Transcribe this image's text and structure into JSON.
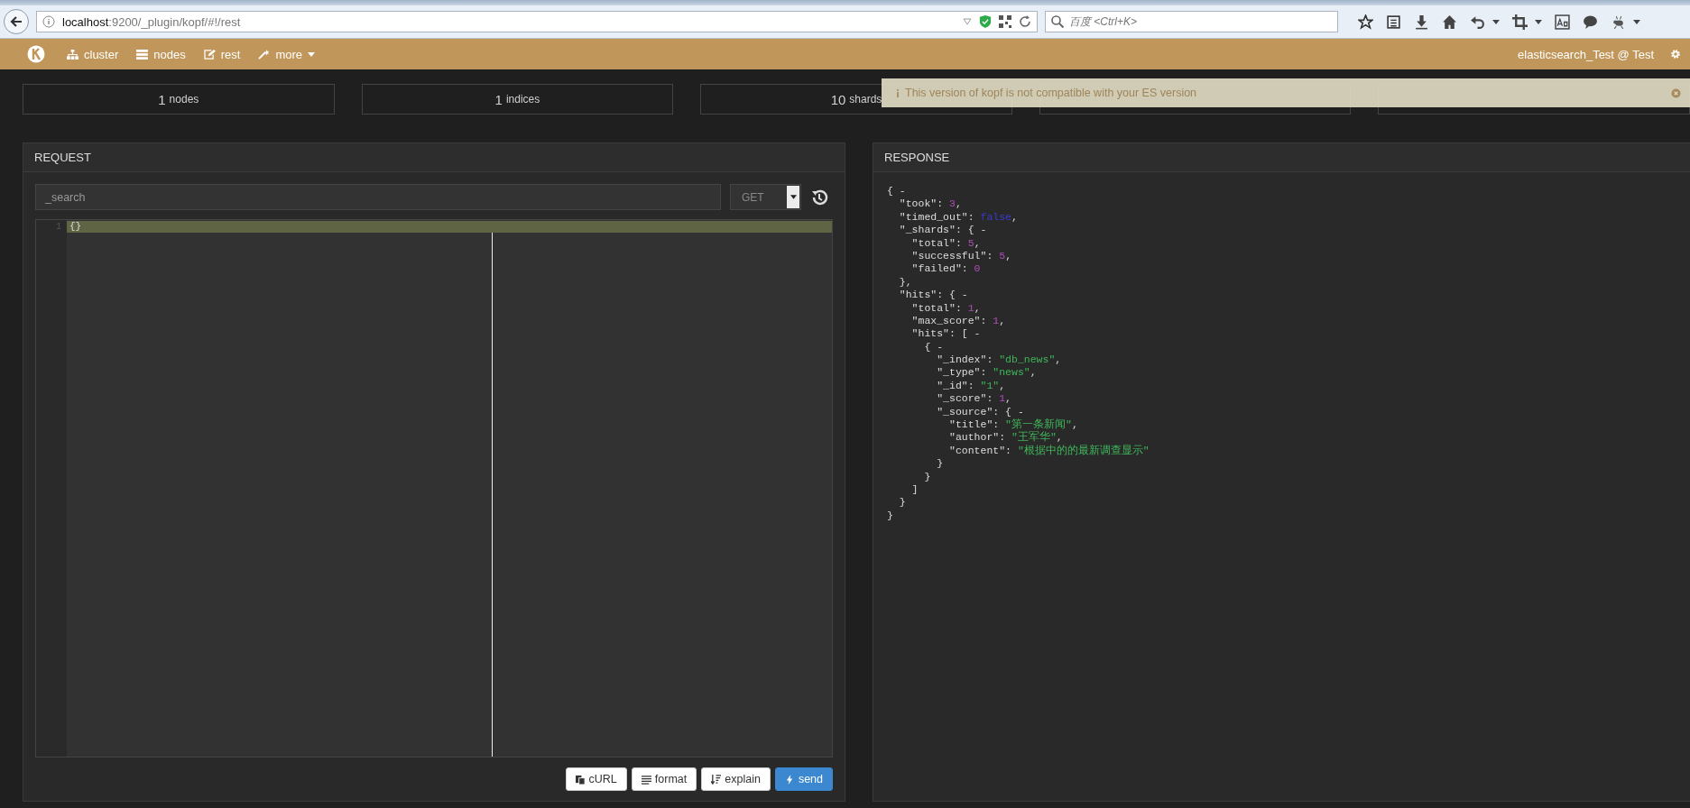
{
  "browser": {
    "url_host": "localhost",
    "url_rest": ":9200/_plugin/kopf/#!/rest",
    "search_placeholder": "百度 <Ctrl+K>"
  },
  "navbar": {
    "items": [
      {
        "label": "cluster",
        "dropdown": false
      },
      {
        "label": "nodes",
        "dropdown": false
      },
      {
        "label": "rest",
        "dropdown": false
      },
      {
        "label": "more",
        "dropdown": true
      }
    ],
    "cluster_name": "elasticsearch_Test @ Test"
  },
  "stats": [
    {
      "value": "1",
      "label": "nodes"
    },
    {
      "value": "1",
      "label": "indices"
    },
    {
      "value": "10",
      "label": "shards"
    }
  ],
  "alert": {
    "message": "This version of kopf is not compatible with your ES version"
  },
  "request": {
    "title": "REQUEST",
    "path": "_search",
    "method": "GET",
    "editor_lines": [
      {
        "number": "1",
        "text": "{}",
        "highlighted": true
      }
    ],
    "buttons": [
      {
        "label": "cURL",
        "kind": "curl",
        "primary": false
      },
      {
        "label": "format",
        "kind": "format",
        "primary": false
      },
      {
        "label": "explain",
        "kind": "explain",
        "primary": false
      },
      {
        "label": "send",
        "kind": "send",
        "primary": true
      }
    ]
  },
  "response": {
    "title": "RESPONSE",
    "body": {
      "line": [
        {
          "kind": "text",
          "text": "{ -"
        }
      ],
      "close": [
        {
          "kind": "text",
          "text": "}"
        }
      ],
      "children": [
        {
          "line": [
            {
              "kind": "text",
              "text": "\"took\": "
            },
            {
              "kind": "number",
              "text": "3"
            },
            {
              "kind": "text",
              "text": ","
            }
          ]
        },
        {
          "line": [
            {
              "kind": "text",
              "text": "\"timed_out\": "
            },
            {
              "kind": "boolean",
              "text": "false"
            },
            {
              "kind": "text",
              "text": ","
            }
          ]
        },
        {
          "line": [
            {
              "kind": "text",
              "text": "\"_shards\": { -"
            }
          ],
          "close": [
            {
              "kind": "text",
              "text": "},"
            }
          ],
          "children": [
            {
              "line": [
                {
                  "kind": "text",
                  "text": "\"total\": "
                },
                {
                  "kind": "number",
                  "text": "5"
                },
                {
                  "kind": "text",
                  "text": ","
                }
              ]
            },
            {
              "line": [
                {
                  "kind": "text",
                  "text": "\"successful\": "
                },
                {
                  "kind": "number",
                  "text": "5"
                },
                {
                  "kind": "text",
                  "text": ","
                }
              ]
            },
            {
              "line": [
                {
                  "kind": "text",
                  "text": "\"failed\": "
                },
                {
                  "kind": "number",
                  "text": "0"
                }
              ]
            }
          ]
        },
        {
          "line": [
            {
              "kind": "text",
              "text": "\"hits\": { -"
            }
          ],
          "close": [
            {
              "kind": "text",
              "text": "}"
            }
          ],
          "children": [
            {
              "line": [
                {
                  "kind": "text",
                  "text": "\"total\": "
                },
                {
                  "kind": "number",
                  "text": "1"
                },
                {
                  "kind": "text",
                  "text": ","
                }
              ]
            },
            {
              "line": [
                {
                  "kind": "text",
                  "text": "\"max_score\": "
                },
                {
                  "kind": "number",
                  "text": "1"
                },
                {
                  "kind": "text",
                  "text": ","
                }
              ]
            },
            {
              "line": [
                {
                  "kind": "text",
                  "text": "\"hits\": [ -"
                }
              ],
              "close": [
                {
                  "kind": "text",
                  "text": "]"
                }
              ],
              "children": [
                {
                  "line": [
                    {
                      "kind": "text",
                      "text": "{ -"
                    }
                  ],
                  "close": [
                    {
                      "kind": "text",
                      "text": "}"
                    }
                  ],
                  "children": [
                    {
                      "line": [
                        {
                          "kind": "text",
                          "text": "\"_index\": "
                        },
                        {
                          "kind": "string",
                          "text": "\"db_news\""
                        },
                        {
                          "kind": "text",
                          "text": ","
                        }
                      ]
                    },
                    {
                      "line": [
                        {
                          "kind": "text",
                          "text": "\"_type\": "
                        },
                        {
                          "kind": "string",
                          "text": "\"news\""
                        },
                        {
                          "kind": "text",
                          "text": ","
                        }
                      ]
                    },
                    {
                      "line": [
                        {
                          "kind": "text",
                          "text": "\"_id\": "
                        },
                        {
                          "kind": "string",
                          "text": "\"1\""
                        },
                        {
                          "kind": "text",
                          "text": ","
                        }
                      ]
                    },
                    {
                      "line": [
                        {
                          "kind": "text",
                          "text": "\"_score\": "
                        },
                        {
                          "kind": "number",
                          "text": "1"
                        },
                        {
                          "kind": "text",
                          "text": ","
                        }
                      ]
                    },
                    {
                      "line": [
                        {
                          "kind": "text",
                          "text": "\"_source\": { -"
                        }
                      ],
                      "close": [
                        {
                          "kind": "text",
                          "text": "}"
                        }
                      ],
                      "children": [
                        {
                          "line": [
                            {
                              "kind": "text",
                              "text": "\"title\": "
                            },
                            {
                              "kind": "string",
                              "text": "\"第一条新闻\""
                            },
                            {
                              "kind": "text",
                              "text": ","
                            }
                          ]
                        },
                        {
                          "line": [
                            {
                              "kind": "text",
                              "text": "\"author\": "
                            },
                            {
                              "kind": "string",
                              "text": "\"王军华\""
                            },
                            {
                              "kind": "text",
                              "text": ","
                            }
                          ]
                        },
                        {
                          "line": [
                            {
                              "kind": "text",
                              "text": "\"content\": "
                            },
                            {
                              "kind": "string",
                              "text": "\"根据中的的最新调查显示\""
                            }
                          ]
                        }
                      ]
                    }
                  ]
                }
              ]
            }
          ]
        }
      ]
    }
  }
}
